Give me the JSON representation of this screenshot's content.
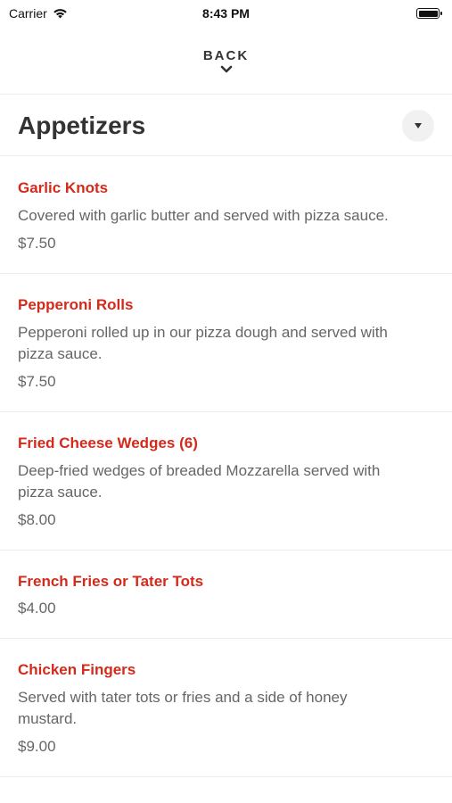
{
  "status_bar": {
    "carrier": "Carrier",
    "time": "8:43 PM",
    "wifi_icon": "wifi-icon",
    "battery_icon": "battery-icon"
  },
  "nav": {
    "back_label": "BACK",
    "chevron_icon": "chevron-down-icon"
  },
  "section": {
    "title": "Appetizers",
    "toggle_icon": "caret-down-icon"
  },
  "items": [
    {
      "name": "Garlic Knots",
      "description": "Covered with garlic butter and served with pizza sauce.",
      "price": "$7.50"
    },
    {
      "name": "Pepperoni Rolls",
      "description": "Pepperoni rolled up in our pizza dough and served with pizza sauce.",
      "price": "$7.50"
    },
    {
      "name": "Fried Cheese Wedges (6)",
      "description": "Deep-fried wedges of breaded Mozzarella served with pizza sauce.",
      "price": "$8.00"
    },
    {
      "name": "French Fries or Tater Tots",
      "description": "",
      "price": "$4.00"
    },
    {
      "name": "Chicken Fingers",
      "description": "Served with tater tots or fries and a side of honey mustard.",
      "price": "$9.00"
    }
  ],
  "colors": {
    "accent": "#d42a1c",
    "text": "#333333",
    "muted": "#666666"
  }
}
